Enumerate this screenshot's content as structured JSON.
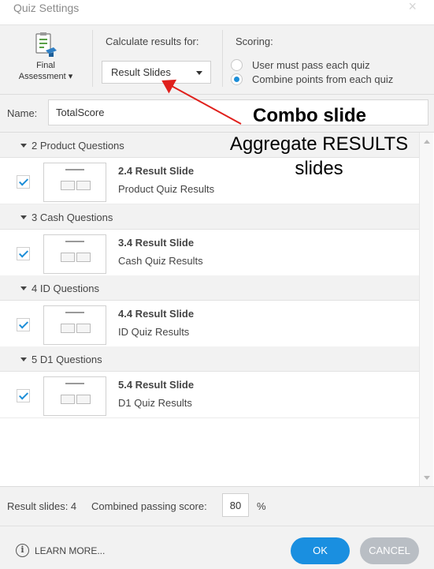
{
  "window": {
    "title": "Quiz Settings",
    "close_glyph": "×"
  },
  "ribbon": {
    "final_assessment": {
      "line1": "Final",
      "line2": "Assessment",
      "icon": "clipboard-quiz-icon"
    },
    "calculate_label": "Calculate results for:",
    "calculate_value": "Result Slides",
    "scoring_label": "Scoring:",
    "scoring_options": [
      {
        "label": "User must pass each quiz",
        "selected": false
      },
      {
        "label": "Combine points from each quiz",
        "selected": true
      }
    ]
  },
  "name": {
    "label": "Name:",
    "value": "TotalScore"
  },
  "groups": [
    {
      "title": "2 Product Questions",
      "slide_title": "2.4 Result Slide",
      "slide_sub": "Product Quiz Results",
      "checked": true
    },
    {
      "title": "3 Cash Questions",
      "slide_title": "3.4 Result Slide",
      "slide_sub": "Cash Quiz Results",
      "checked": true
    },
    {
      "title": "4 ID Questions",
      "slide_title": "4.4 Result Slide",
      "slide_sub": "ID Quiz Results",
      "checked": true
    },
    {
      "title": "5 D1 Questions",
      "slide_title": "5.4 Result Slide",
      "slide_sub": "D1 Quiz Results",
      "checked": true
    }
  ],
  "summary": {
    "result_slides": "Result slides: 4",
    "combined_label": "Combined passing score:",
    "combined_value": "80",
    "percent": "%"
  },
  "footer": {
    "learn_more": "LEARN MORE...",
    "ok": "OK",
    "cancel": "CANCEL"
  },
  "annotation": {
    "heading": "Combo slide",
    "body": "Aggregate RESULTS slides",
    "arrow_color": "#e0201c"
  },
  "colors": {
    "accent": "#1a8fe0",
    "cancel": "#b9bec4"
  }
}
